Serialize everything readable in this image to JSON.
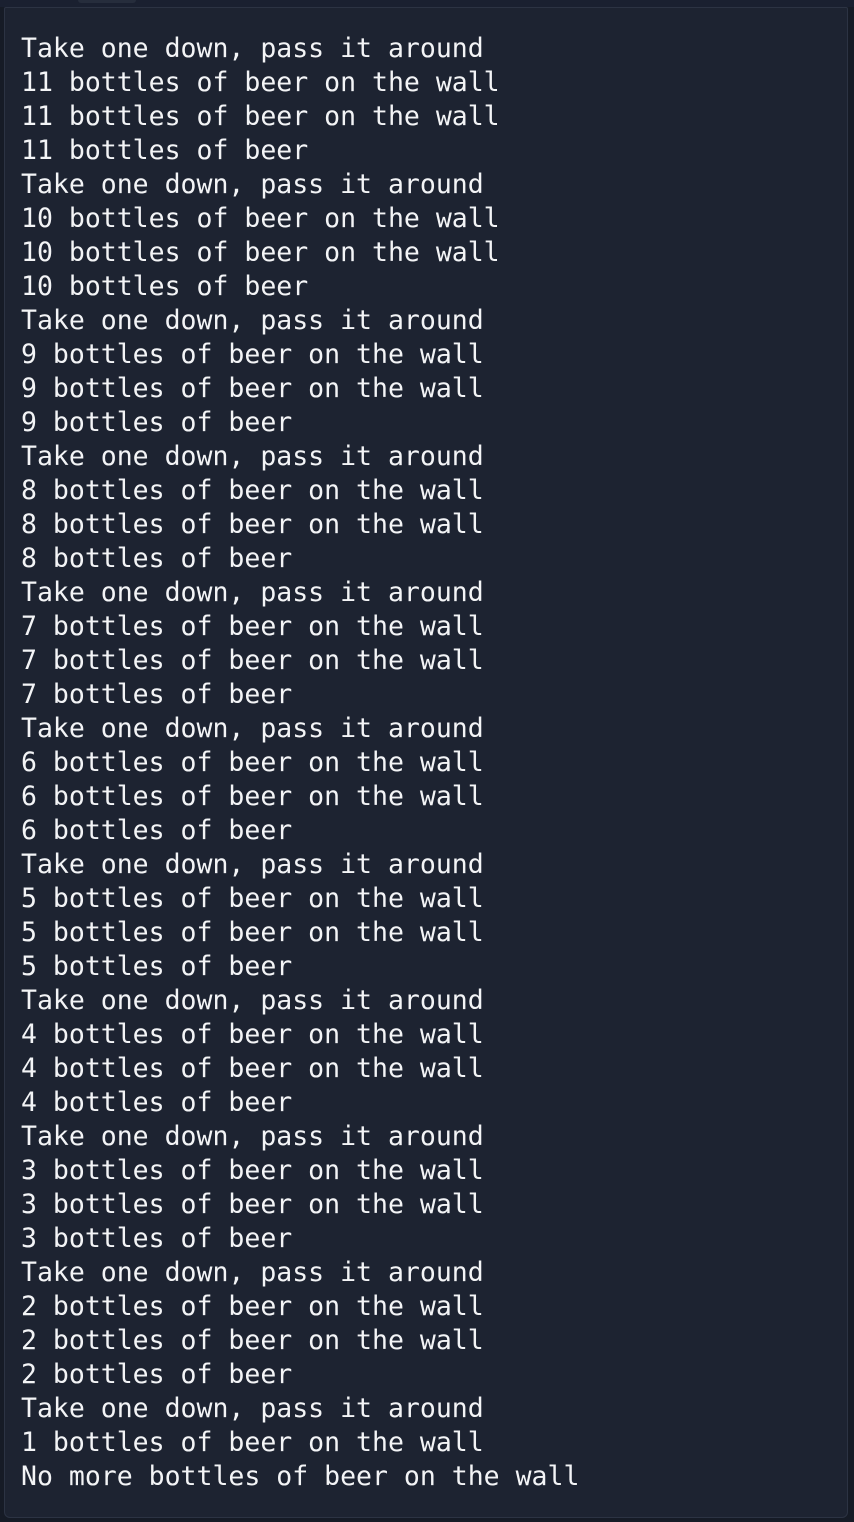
{
  "terminal": {
    "lines": [
      "Take one down, pass it around",
      "11 bottles of beer on the wall",
      "11 bottles of beer on the wall",
      "11 bottles of beer",
      "Take one down, pass it around",
      "10 bottles of beer on the wall",
      "10 bottles of beer on the wall",
      "10 bottles of beer",
      "Take one down, pass it around",
      "9 bottles of beer on the wall",
      "9 bottles of beer on the wall",
      "9 bottles of beer",
      "Take one down, pass it around",
      "8 bottles of beer on the wall",
      "8 bottles of beer on the wall",
      "8 bottles of beer",
      "Take one down, pass it around",
      "7 bottles of beer on the wall",
      "7 bottles of beer on the wall",
      "7 bottles of beer",
      "Take one down, pass it around",
      "6 bottles of beer on the wall",
      "6 bottles of beer on the wall",
      "6 bottles of beer",
      "Take one down, pass it around",
      "5 bottles of beer on the wall",
      "5 bottles of beer on the wall",
      "5 bottles of beer",
      "Take one down, pass it around",
      "4 bottles of beer on the wall",
      "4 bottles of beer on the wall",
      "4 bottles of beer",
      "Take one down, pass it around",
      "3 bottles of beer on the wall",
      "3 bottles of beer on the wall",
      "3 bottles of beer",
      "Take one down, pass it around",
      "2 bottles of beer on the wall",
      "2 bottles of beer on the wall",
      "2 bottles of beer",
      "Take one down, pass it around",
      "1 bottles of beer on the wall",
      "No more bottles of beer on the wall"
    ]
  },
  "colors": {
    "background": "#1d2331",
    "text": "#f3f4f6"
  }
}
